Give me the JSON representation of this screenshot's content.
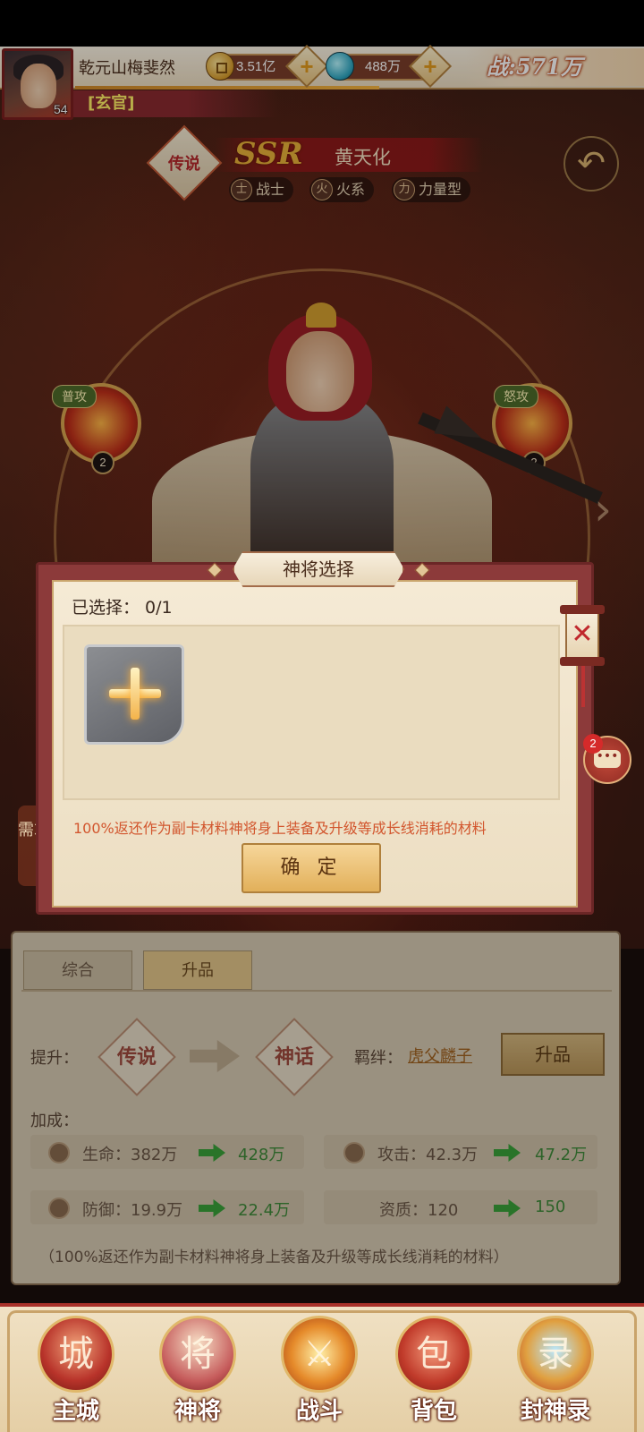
{
  "player": {
    "name": "乾元山梅斐然",
    "level": "54",
    "rank": "[玄官]",
    "gold": "3.51亿",
    "jade": "488万",
    "power": "战:571万"
  },
  "hero": {
    "rarity": "SSR",
    "name": "黄天化",
    "grade_badge": "传说",
    "tags": [
      {
        "icon": "warrior-class-icon",
        "glyph": "士",
        "label": "战士"
      },
      {
        "icon": "fire-element-icon",
        "glyph": "火",
        "label": "火系"
      },
      {
        "icon": "strength-type-icon",
        "glyph": "力",
        "label": "力量型"
      }
    ],
    "skills": [
      {
        "label": "普攻",
        "level": "2"
      },
      {
        "label": "怒攻",
        "level": "2"
      }
    ]
  },
  "demand_tab": "需求",
  "modal": {
    "title": "神将选择",
    "selected": "已选择： 0/1",
    "note": "100%返还作为副卡材料神将身上装备及升级等成长线消耗的材料",
    "confirm": "确 定",
    "close_glyph": "✕",
    "chat_badge": "2"
  },
  "panel": {
    "tabs": [
      "综合",
      "升品"
    ],
    "upgrade_label": "提升：",
    "from_grade": "传说",
    "to_grade": "神话",
    "bond_label": "羁绊：",
    "bond_link": "虎父麟子",
    "upgrade_button": "升品",
    "bonus_label": "加成：",
    "stats": [
      {
        "label": "生命：382万",
        "new": "428万"
      },
      {
        "label": "攻击：42.3万",
        "new": "47.2万"
      },
      {
        "label": "防御：19.9万",
        "new": "22.4万"
      },
      {
        "label": "资质：120",
        "new": "150"
      }
    ],
    "footnote": "（100%返还作为副卡材料神将身上装备及升级等成长线消耗的材料）"
  },
  "nav": [
    {
      "label": "主城",
      "icon": "main-city-icon",
      "glyph": "城"
    },
    {
      "label": "神将",
      "icon": "hero-icon",
      "glyph": "将"
    },
    {
      "label": "战斗",
      "icon": "battle-swords-icon",
      "glyph": "⚔"
    },
    {
      "label": "背包",
      "icon": "backpack-icon",
      "glyph": "包"
    },
    {
      "label": "封神录",
      "icon": "god-record-icon",
      "glyph": "录"
    }
  ]
}
